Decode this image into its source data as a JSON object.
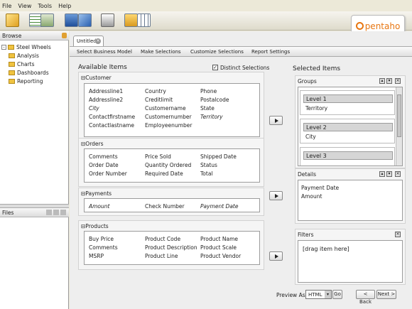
{
  "menu": [
    "File",
    "View",
    "Tools",
    "Help"
  ],
  "logo_text": "pentaho",
  "browse": {
    "title": "Browse",
    "root": "Steel Wheels",
    "items": [
      "Analysis",
      "Charts",
      "Dashboards",
      "Reporting"
    ]
  },
  "files_title": "Files",
  "tab_label": "Untitled",
  "steps": [
    "Select Business Model",
    "Make Selections",
    "Customize Selections",
    "Report Settings"
  ],
  "available_title": "Available Items",
  "distinct_label": "Distinct Selections",
  "groups": {
    "customer": {
      "title": "Customer",
      "rows": [
        [
          "Addressline1",
          "Country",
          "Phone"
        ],
        [
          "Addressline2",
          "Creditlimit",
          "Postalcode"
        ],
        [
          "City",
          "Customername",
          "State"
        ],
        [
          "Contactfirstname",
          "Customernumber",
          "Territory"
        ],
        [
          "Contactlastname",
          "Employeenumber",
          ""
        ]
      ]
    },
    "orders": {
      "title": "Orders",
      "rows": [
        [
          "Comments",
          "Price Sold",
          "Shipped Date"
        ],
        [
          "Order Date",
          "Quantity Ordered",
          "Status"
        ],
        [
          "Order Number",
          "Required Date",
          "Total"
        ]
      ]
    },
    "payments": {
      "title": "Payments",
      "rows": [
        [
          "Amount",
          "Check Number",
          "Payment Date"
        ]
      ]
    },
    "products": {
      "title": "Products",
      "rows": [
        [
          "Buy Price",
          "Product Code",
          "Product Name"
        ],
        [
          "Comments",
          "Product Description",
          "Product Scale"
        ],
        [
          "MSRP",
          "Product Line",
          "Product Vendor"
        ]
      ]
    }
  },
  "selected_title": "Selected Items",
  "sel_groups": {
    "title": "Groups",
    "levels": [
      {
        "name": "Level 1",
        "value": "Territory"
      },
      {
        "name": "Level 2",
        "value": "City"
      },
      {
        "name": "Level 3",
        "value": ""
      }
    ]
  },
  "details": {
    "title": "Details",
    "items": [
      "Payment Date",
      "Amount"
    ]
  },
  "filters": {
    "title": "Filters",
    "placeholder": "[drag item here]"
  },
  "footer": {
    "preview_label": "Preview As:",
    "preview_value": "HTML",
    "go": "Go",
    "back": "< Back",
    "next": "Next >"
  }
}
